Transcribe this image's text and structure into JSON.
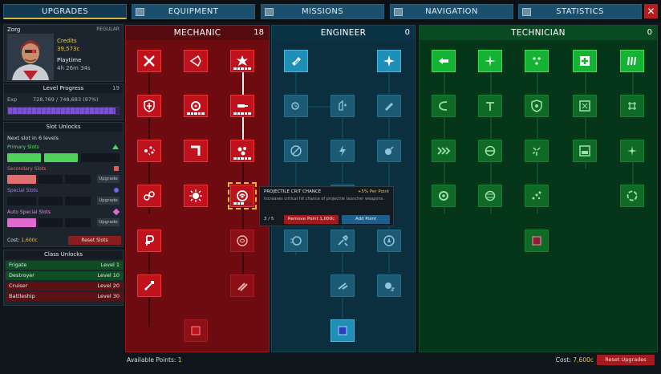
{
  "tabs": [
    {
      "label": "Upgrades",
      "active": true
    },
    {
      "label": "Equipment",
      "active": false
    },
    {
      "label": "Missions",
      "active": false
    },
    {
      "label": "Navigation",
      "active": false
    },
    {
      "label": "Statistics",
      "active": false
    }
  ],
  "close_label": "✕",
  "profile": {
    "name": "Zorg",
    "rank": "Regular",
    "credits_label": "Credits",
    "credits_value": "39,573c",
    "playtime_label": "Playtime",
    "playtime_value": "4h 26m 34s"
  },
  "level_progress": {
    "title": "Level Progress",
    "level": "19",
    "exp_label": "Exp",
    "exp_value": "728,769 / 748,683 (97%)",
    "fraction": 0.97
  },
  "slot_unlocks": {
    "title": "Slot Unlocks",
    "next_slot": "Next slot in 6 levels",
    "primary_label": "Primary Slots",
    "secondary_label": "Secondary Slots",
    "special_label": "Special Slots",
    "auto_special_label": "Auto Special Slots",
    "upgrade_label": "Upgrade",
    "cost_label": "Cost:",
    "cost_value": "1,600c",
    "reset_label": "Reset Slots"
  },
  "class_unlocks": {
    "title": "Class Unlocks",
    "rows": [
      {
        "name": "Frigate",
        "level": "Level 1",
        "unlocked": true
      },
      {
        "name": "Destroyer",
        "level": "Level 10",
        "unlocked": true
      },
      {
        "name": "Cruiser",
        "level": "Level 20",
        "unlocked": false
      },
      {
        "name": "Battleship",
        "level": "Level 30",
        "unlocked": false
      }
    ]
  },
  "trees": {
    "mechanic": {
      "title": "Mechanic",
      "points": "18"
    },
    "engineer": {
      "title": "Engineer",
      "points": "0"
    },
    "technician": {
      "title": "Technician",
      "points": "0"
    }
  },
  "tooltip": {
    "title": "Projectile Crit Chance",
    "per_point": "+5% Per Point",
    "description": "Increases critical hit chance of projectile launcher weapons.",
    "rank": "3 / 5",
    "remove_label": "Remove Point 1,000c",
    "add_label": "Add Point"
  },
  "footer": {
    "available_label": "Available Points:",
    "available_value": "1",
    "cost_label": "Cost:",
    "cost_value": "7,600c",
    "reset_label": "Reset Upgrades"
  },
  "colors": {
    "mechanic": "#c0121c",
    "engineer": "#1f8fb8",
    "technician": "#15b334",
    "accent": "#e3c766"
  }
}
